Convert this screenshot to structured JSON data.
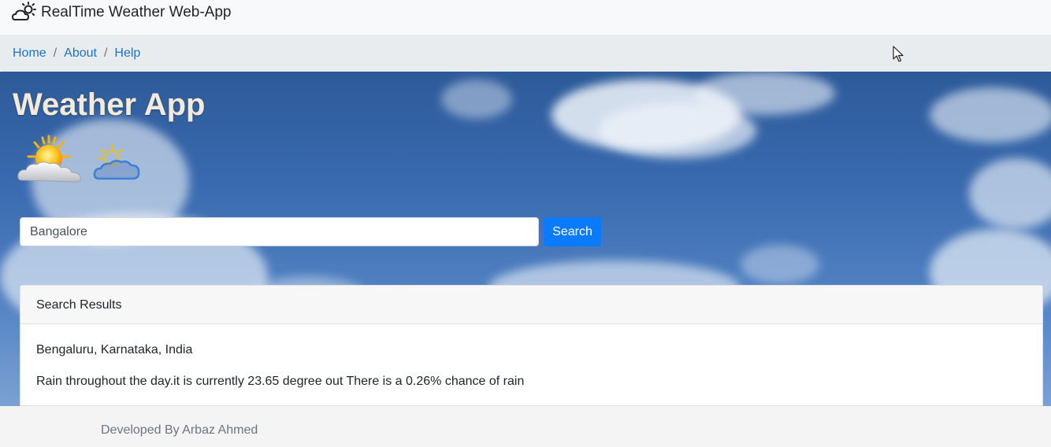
{
  "navbar": {
    "brand_icon": "sun-cloud-icon",
    "brand_title": "RealTime Weather Web-App"
  },
  "breadcrumb": {
    "items": [
      {
        "label": "Home"
      },
      {
        "label": "About"
      },
      {
        "label": "Help"
      }
    ],
    "separator": "/"
  },
  "hero": {
    "title": "Weather App",
    "icons": [
      "sunny-cloud-icon",
      "partly-cloudy-icon"
    ]
  },
  "search": {
    "value": "Bangalore",
    "button_label": "Search"
  },
  "results": {
    "header": "Search Results",
    "location": "Bengaluru, Karnataka, India",
    "summary": "Rain throughout the day.it is currently 23.65 degree out There is a 0.26% chance of rain"
  },
  "footer": {
    "text": "Developed By Arbaz Ahmed"
  },
  "colors": {
    "accent": "#0a7bff",
    "link": "#1a73c9",
    "title": "#f5ead8"
  }
}
